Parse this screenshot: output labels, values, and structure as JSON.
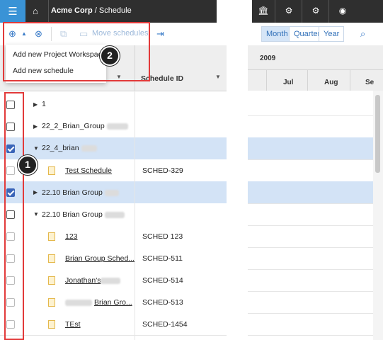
{
  "header": {
    "company": "Acme Corp",
    "page": "/ Schedule",
    "icons": [
      "menu-icon",
      "home-icon",
      "bank-icon",
      "settings-icon",
      "admin-icon",
      "user-icon"
    ]
  },
  "toolbar": {
    "move_label": "Move schedules"
  },
  "dropdown": {
    "items": [
      "Add new Project Workspace",
      "Add new schedule"
    ]
  },
  "zoom": {
    "month": "Month",
    "quarter": "Quarter",
    "year": "Year"
  },
  "gantt": {
    "year": "2009",
    "months": [
      "Jul",
      "Aug",
      "Se"
    ]
  },
  "columns": {
    "schedule_id": "Schedule ID"
  },
  "annotations": {
    "one": "1",
    "two": "2"
  },
  "rows": [
    {
      "name": "1",
      "id": "",
      "checked": false,
      "type": "folder",
      "expanded": false
    },
    {
      "name": "22_2_Brian_Group",
      "id": "",
      "checked": false,
      "type": "folder",
      "expanded": false
    },
    {
      "name": "22_4_brian",
      "id": "",
      "checked": true,
      "type": "folder",
      "expanded": true
    },
    {
      "name": "Test Schedule",
      "id": "SCHED-329",
      "checked": false,
      "type": "schedule"
    },
    {
      "name": "22.10 Brian Group",
      "id": "",
      "checked": true,
      "type": "folder",
      "expanded": false
    },
    {
      "name": "22.10 Brian Group",
      "id": "",
      "checked": false,
      "type": "folder",
      "expanded": true
    },
    {
      "name": "123",
      "id": "SCHED 123",
      "checked": false,
      "type": "schedule"
    },
    {
      "name": "Brian Group Sched...",
      "id": "SCHED-511",
      "checked": false,
      "type": "schedule"
    },
    {
      "name": "Jonathan's",
      "id": "SCHED-514",
      "checked": false,
      "type": "schedule"
    },
    {
      "name": "Brian Gro...",
      "id": "SCHED-513",
      "checked": false,
      "type": "schedule"
    },
    {
      "name": "TEst",
      "id": "SCHED-1454",
      "checked": false,
      "type": "schedule"
    }
  ]
}
